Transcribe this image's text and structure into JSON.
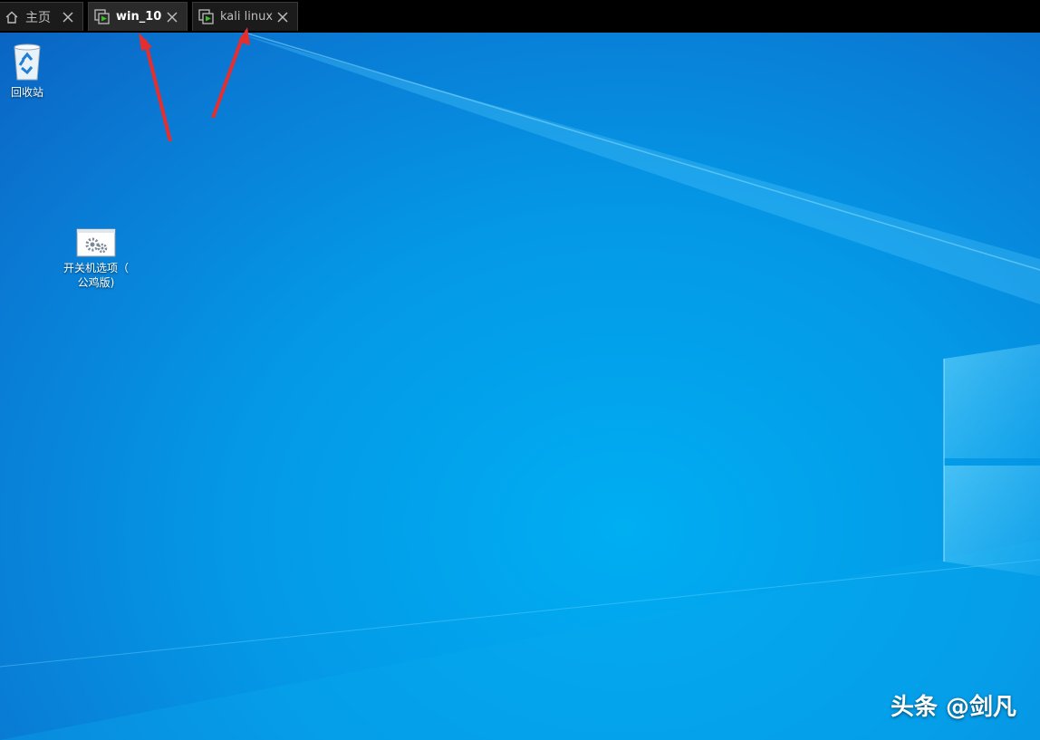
{
  "tabs": [
    {
      "label": "主页",
      "icon": "home-icon"
    },
    {
      "label": "win_10",
      "icon": "vm-play-icon",
      "active": true
    },
    {
      "label": "kali linux",
      "icon": "vm-play-icon"
    }
  ],
  "desktop": {
    "icons": [
      {
        "label": "回收站",
        "icon": "recycle-bin-icon"
      },
      {
        "label_line1": "开关机选项（",
        "label_line2": "公鸡版)",
        "icon": "settings-gears-icon"
      }
    ],
    "watermark": "头条 @剑凡"
  },
  "colors": {
    "accent_green": "#3dbb2b",
    "annotation_red": "#e62e2e",
    "desktop_blue": "#0a8ce0"
  }
}
